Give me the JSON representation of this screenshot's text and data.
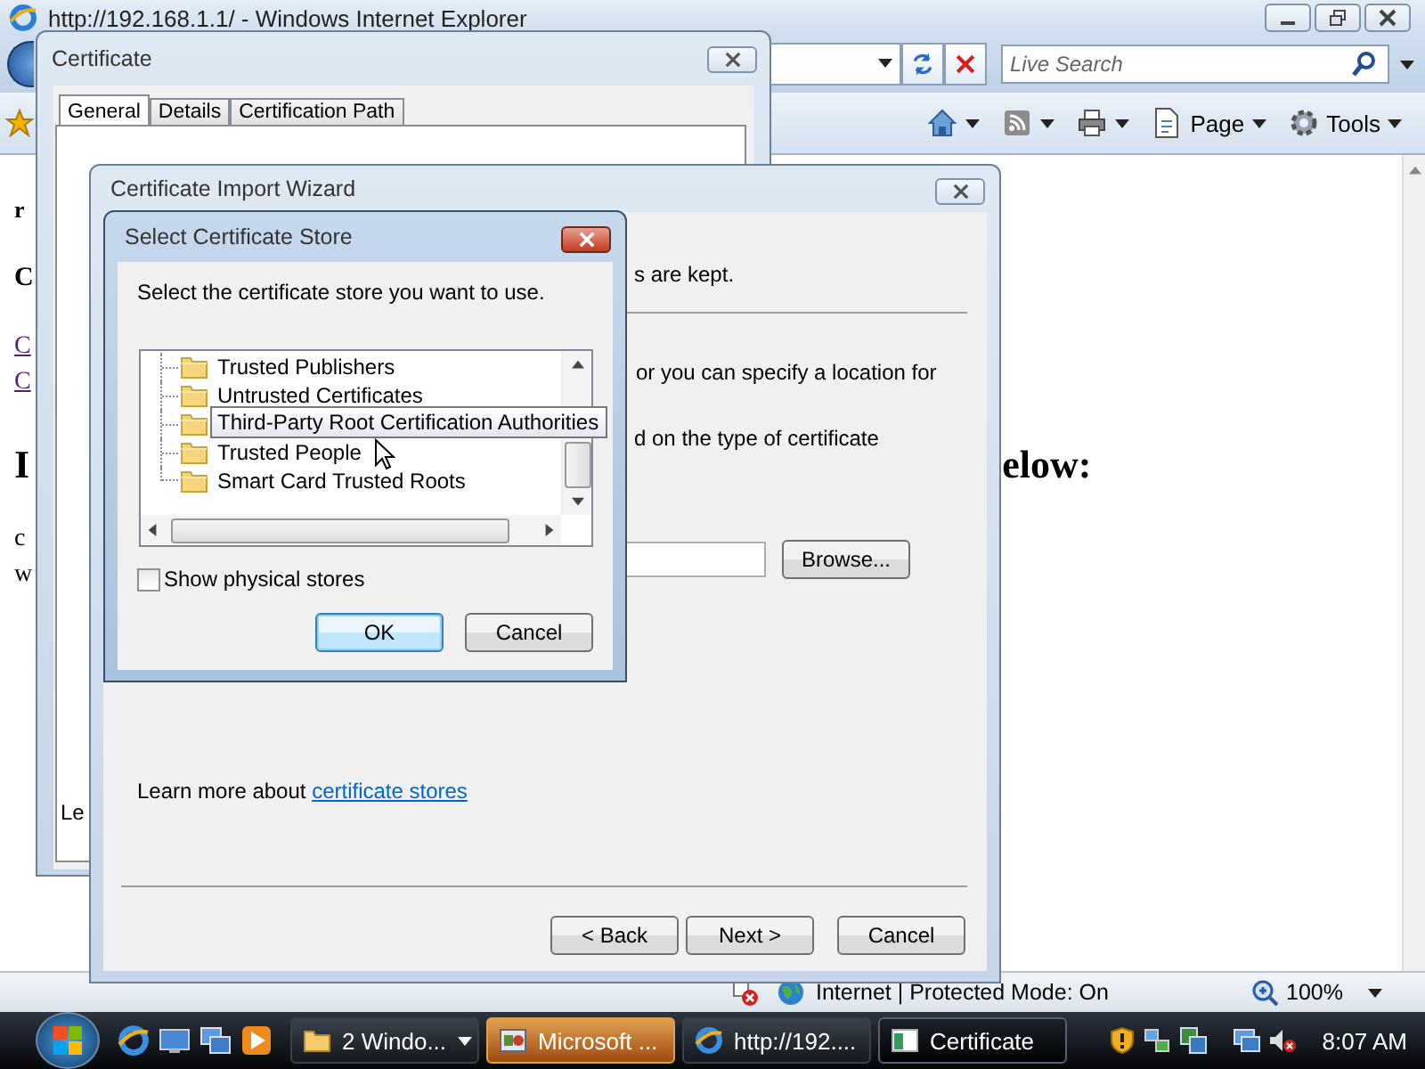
{
  "browser": {
    "title": "http://192.168.1.1/ - Windows Internet Explorer",
    "search_placeholder": "Live Search",
    "commands": [
      {
        "kind": "home"
      },
      {
        "kind": "feeds"
      },
      {
        "kind": "print"
      },
      {
        "kind": "page",
        "label": "Page"
      },
      {
        "kind": "tools",
        "label": "Tools"
      }
    ],
    "page": [
      {
        "kind": "small",
        "text": "r"
      },
      {
        "kind": "title",
        "text": "C"
      },
      {
        "kind": "link",
        "text": "C"
      },
      {
        "kind": "link",
        "text": "C"
      },
      {
        "kind": "heading",
        "text": "I"
      },
      {
        "kind": "text",
        "text": "c"
      },
      {
        "kind": "text",
        "text": "w"
      }
    ],
    "heading_tail": "elow:",
    "status": {
      "zone": "Internet | Protected Mode: On",
      "zoom": "100%"
    }
  },
  "certificate_window": {
    "title": "Certificate",
    "tabs": [
      {
        "label": "General",
        "selected": true
      },
      {
        "label": "Details",
        "selected": false
      },
      {
        "label": "Certification Path",
        "selected": false
      }
    ],
    "body_fragment": "Le"
  },
  "import_wizard": {
    "title": "Certificate Import Wizard",
    "fragments": [
      "s are kept.",
      "or you can specify a location for",
      "d on the type of certificate"
    ],
    "browse_button": "Browse...",
    "learn_more": "Learn more about",
    "learn_more_link": "certificate stores",
    "buttons": [
      "< Back",
      "Next >",
      "Cancel"
    ]
  },
  "store_dialog": {
    "title": "Select Certificate Store",
    "prompt": "Select the certificate store you want to use.",
    "stores": [
      {
        "label": "Trusted Publishers",
        "hovered": false
      },
      {
        "label": "Untrusted Certificates",
        "hovered": false
      },
      {
        "label": "Third-Party Root Certification Authorities",
        "hovered": true
      },
      {
        "label": "Trusted People",
        "hovered": false
      },
      {
        "label": "Smart Card Trusted Roots",
        "hovered": false
      }
    ],
    "show_physical_stores": {
      "label": "Show physical stores",
      "checked": false
    },
    "buttons": [
      "OK",
      "Cancel"
    ]
  },
  "taskbar": {
    "tasks": [
      {
        "kind": "folder",
        "label": "2 Windo...",
        "selected": false,
        "flashing": false
      },
      {
        "kind": "console",
        "label": "Microsoft ...",
        "selected": false,
        "flashing": true
      },
      {
        "kind": "browser",
        "label": "http://192....",
        "selected": false,
        "flashing": false
      },
      {
        "kind": "window",
        "label": "Certificate",
        "selected": true,
        "flashing": false
      }
    ],
    "clock": "8:07 AM"
  }
}
